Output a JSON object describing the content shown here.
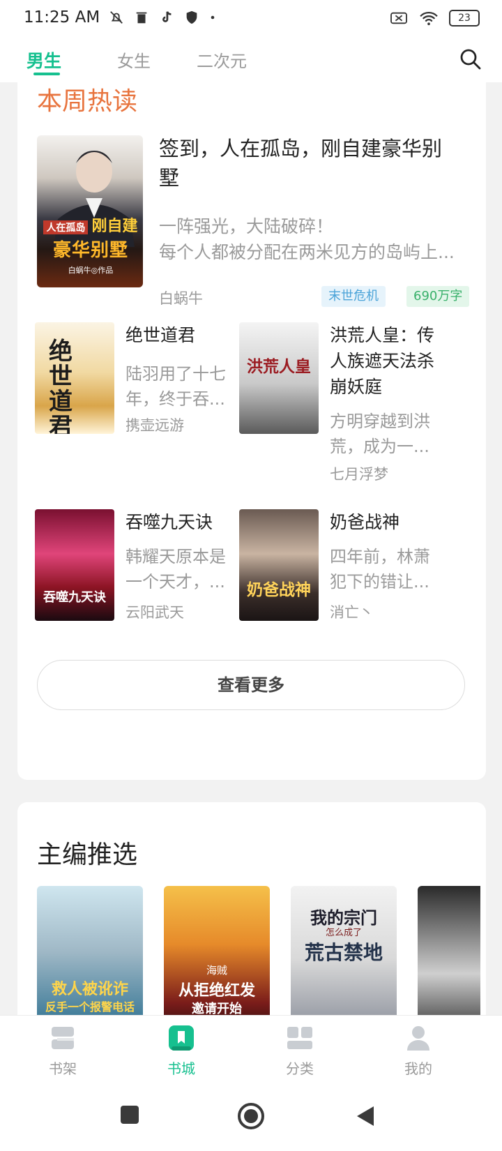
{
  "status_bar": {
    "time": "11:25 AM",
    "battery": "23",
    "left_icons": [
      "mute-icon",
      "trash-icon",
      "tiktok-icon",
      "shield-icon",
      "dot-icon"
    ],
    "right_icons": [
      "no-sim-icon",
      "wifi-icon",
      "battery-icon"
    ]
  },
  "tabs": [
    {
      "label": "男生",
      "active": true
    },
    {
      "label": "女生",
      "active": false
    },
    {
      "label": "二次元",
      "active": false
    }
  ],
  "hot_section": {
    "title": "本周热读",
    "featured": {
      "title": "签到，人在孤岛，刚自建豪华别墅",
      "desc_line1": "一阵强光，大陆破碎！",
      "desc_line2": "每个人都被分配在两米见方的岛屿上...",
      "author": "白蜗牛",
      "tags": [
        "末世危机",
        "690万字"
      ],
      "cover_text": {
        "line1": "人在孤岛",
        "line2": "刚自建",
        "line3": "豪华别墅",
        "line4": "白蜗牛◎作品"
      }
    },
    "books": [
      {
        "title": "绝世道君",
        "desc": [
          "陆羽用了十七",
          "年，终于吞..."
        ],
        "author": "携壶远游",
        "cover_text": "绝世道君"
      },
      {
        "title": "洪荒人皇：传人族遮天法杀崩妖庭",
        "desc": [
          "方明穿越到洪",
          "荒，成为一..."
        ],
        "author": "七月浮梦",
        "cover_text": "洪荒人皇"
      },
      {
        "title": "吞噬九天诀",
        "desc": [
          "韩耀天原本是",
          "一个天才，..."
        ],
        "author": "云阳武天",
        "cover_text": "吞噬九天诀"
      },
      {
        "title": "奶爸战神",
        "desc": [
          "四年前，林萧",
          "犯下的错让..."
        ],
        "author": "消亡丶",
        "cover_text": "奶爸战神"
      }
    ],
    "more_label": "查看更多"
  },
  "editor_section": {
    "title": "主编推选",
    "picks": [
      {
        "cover_text": "救人被讹诈",
        "cover_sub": "反手一个报警电话"
      },
      {
        "cover_text": "从拒绝红发",
        "cover_sub": "邀请开始",
        "cover_tag": "海贼"
      },
      {
        "cover_text": "我的宗门",
        "cover_sub": "荒古禁地",
        "cover_tag": "怎么成了"
      },
      {
        "cover_text": ""
      }
    ]
  },
  "bottom_nav": [
    {
      "label": "书架",
      "icon": "bookshelf-icon",
      "active": false
    },
    {
      "label": "书城",
      "icon": "bookstore-icon",
      "active": true
    },
    {
      "label": "分类",
      "icon": "category-icon",
      "active": false
    },
    {
      "label": "我的",
      "icon": "profile-icon",
      "active": false
    }
  ],
  "colors": {
    "accent": "#16c08f",
    "hot_title": "#e8743e",
    "genre_tag_bg": "#e6f3fb",
    "genre_tag_text": "#4aa3d8",
    "words_tag_bg": "#e3f6ea",
    "words_tag_text": "#38b06a"
  }
}
